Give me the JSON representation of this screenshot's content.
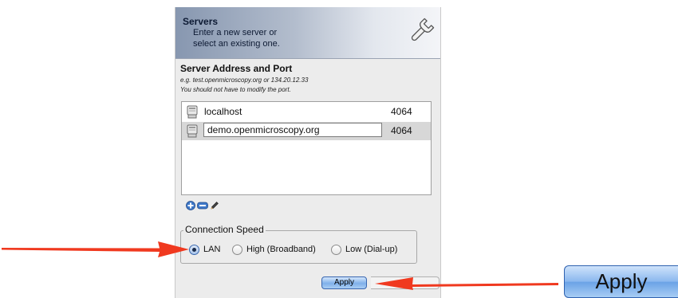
{
  "header": {
    "title": "Servers",
    "subtitle_line1": "Enter a new server or",
    "subtitle_line2": "select an existing one.",
    "icon": "wrench-icon"
  },
  "address_section": {
    "title": "Server Address and Port",
    "hint_example": "e.g. test.openmicroscopy.org or 134.20.12.33",
    "hint_port": "You should not have to modify the port."
  },
  "servers": [
    {
      "host": "localhost",
      "port": "4064",
      "selected": false
    },
    {
      "host": "demo.openmicroscopy.org",
      "port": "4064",
      "selected": true
    }
  ],
  "list_actions": {
    "add_icon": "plus-icon",
    "remove_icon": "minus-icon",
    "edit_icon": "pencil-icon"
  },
  "connection_speed": {
    "legend": "Connection Speed",
    "options": [
      {
        "label": "LAN",
        "checked": true
      },
      {
        "label": "High (Broadband)",
        "checked": false
      },
      {
        "label": "Low (Dial-up)",
        "checked": false
      }
    ]
  },
  "apply_button": {
    "label": "Apply"
  },
  "apply_zoom": {
    "label": "Apply"
  },
  "colors": {
    "arrow": "#f0391f",
    "button_blue": "#7fb0ea",
    "header_blue": "#8797b0"
  }
}
